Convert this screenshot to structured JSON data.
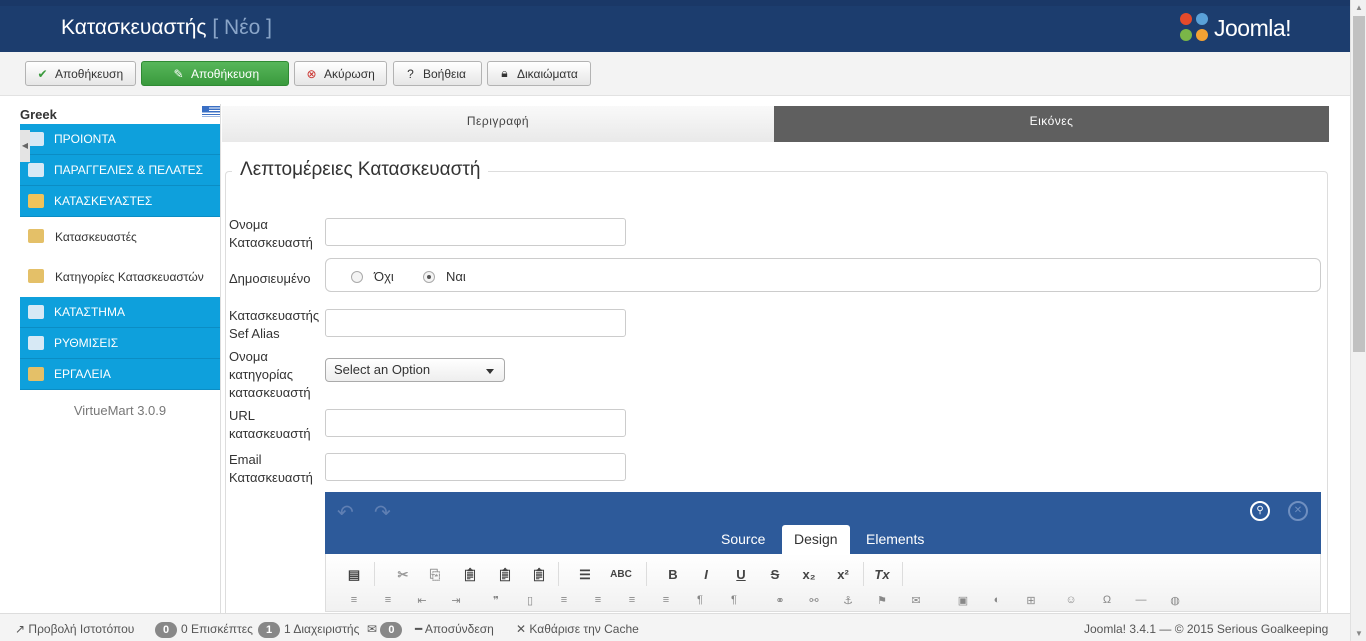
{
  "header": {
    "title": "Κατασκευαστής",
    "subtitle": "[ Νέο ]",
    "brand": "Joomla!"
  },
  "toolbar": {
    "save": "Αποθήκευση",
    "save_close": "Αποθήκευση",
    "cancel": "Ακύρωση",
    "help": "Βοήθεια",
    "permissions": "Δικαιώματα"
  },
  "sidebar": {
    "language": "Greek",
    "items": [
      {
        "label": "ΠΡΟΙΟΝΤΑ"
      },
      {
        "label": "ΠΑΡΑΓΓΕΛΙΕΣ & ΠΕΛΑΤΕΣ"
      },
      {
        "label": "ΚΑΤΑΣΚΕΥΑΣΤΕΣ"
      },
      {
        "label": "Κατασκευαστές"
      },
      {
        "label": "Κατηγορίες Κατασκευαστών"
      },
      {
        "label": "ΚΑΤΑΣΤΗΜΑ"
      },
      {
        "label": "ΡΥΘΜΙΣΕΙΣ"
      },
      {
        "label": "ΕΡΓΑΛΕΙΑ"
      }
    ],
    "version": "VirtueMart 3.0.9"
  },
  "tabs": {
    "description": "Περιγραφή",
    "images": "Εικόνες"
  },
  "form": {
    "legend": "Λεπτομέρειες Κατασκευαστή",
    "name_label_1": "Ονομα",
    "name_label_2": "Κατασκευαστή",
    "published_label": "Δημοσιευμένο",
    "no": "Όχι",
    "yes": "Ναι",
    "published_value": "Ναι",
    "alias_label_1": "Κατασκευαστής",
    "alias_label_2": "Sef Alias",
    "category_label_1": "Ονομα",
    "category_label_2": "κατηγορίας",
    "category_label_3": "κατασκευαστή",
    "category_select": "Select an Option",
    "url_label_1": "URL",
    "url_label_2": "κατασκευαστή",
    "email_label_1": "Email",
    "email_label_2": "Κατασκευαστή"
  },
  "editor": {
    "tab_source": "Source",
    "tab_design": "Design",
    "tab_elements": "Elements",
    "active_tab": "Design"
  },
  "status": {
    "view_site": "Προβολή Ιστοτόπου",
    "visitors_count": "0",
    "visitors": "0 Επισκέπτες",
    "admins_count": "1",
    "admins": "1 Διαχειριστής",
    "messages_count": "0",
    "logout": "Αποσύνδεση",
    "clear_cache": "Καθάρισε την Cache",
    "footer": "Joomla! 3.4.1  —  © 2015 Serious Goalkeeping"
  }
}
